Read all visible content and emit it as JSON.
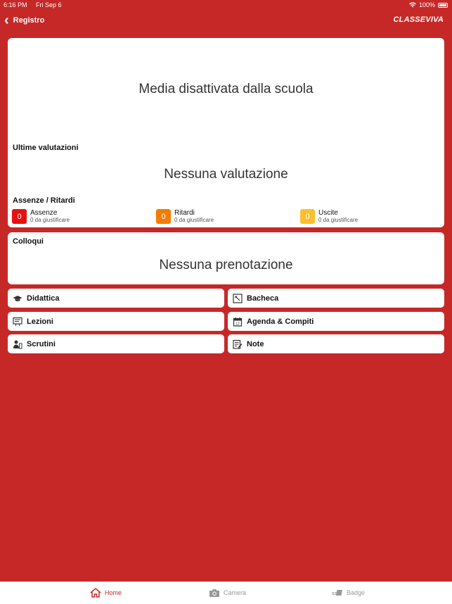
{
  "status": {
    "time": "6:16 PM",
    "date": "Fri Sep 6",
    "battery": "100%"
  },
  "nav": {
    "back_label": "Registro",
    "logo": "CLASSEVIVA"
  },
  "overview": {
    "media_text": "Media disattivata dalla scuola",
    "ultime_title": "Ultime valutazioni",
    "ultime_empty": "Nessuna valutazione",
    "assenze_title": "Assenze / Ritardi",
    "items": [
      {
        "count": "0",
        "label": "Assenze",
        "sub": "0 da giustificare",
        "color": "#e8100f"
      },
      {
        "count": "0",
        "label": "Ritardi",
        "sub": "0 da giustificare",
        "color": "#f57c00"
      },
      {
        "count": "0",
        "label": "Uscite",
        "sub": "0 da giustificare",
        "color": "#fbc02d"
      }
    ]
  },
  "colloqui": {
    "title": "Colloqui",
    "empty": "Nessuna prenotazione"
  },
  "menu": {
    "didattica": "Didattica",
    "bacheca": "Bacheca",
    "lezioni": "Lezioni",
    "agenda": "Agenda & Compiti",
    "scrutini": "Scrutini",
    "note": "Note"
  },
  "tabs": {
    "home": "Home",
    "camera": "Camera",
    "badge": "Badge"
  },
  "colors": {
    "brand": "#c62828"
  }
}
